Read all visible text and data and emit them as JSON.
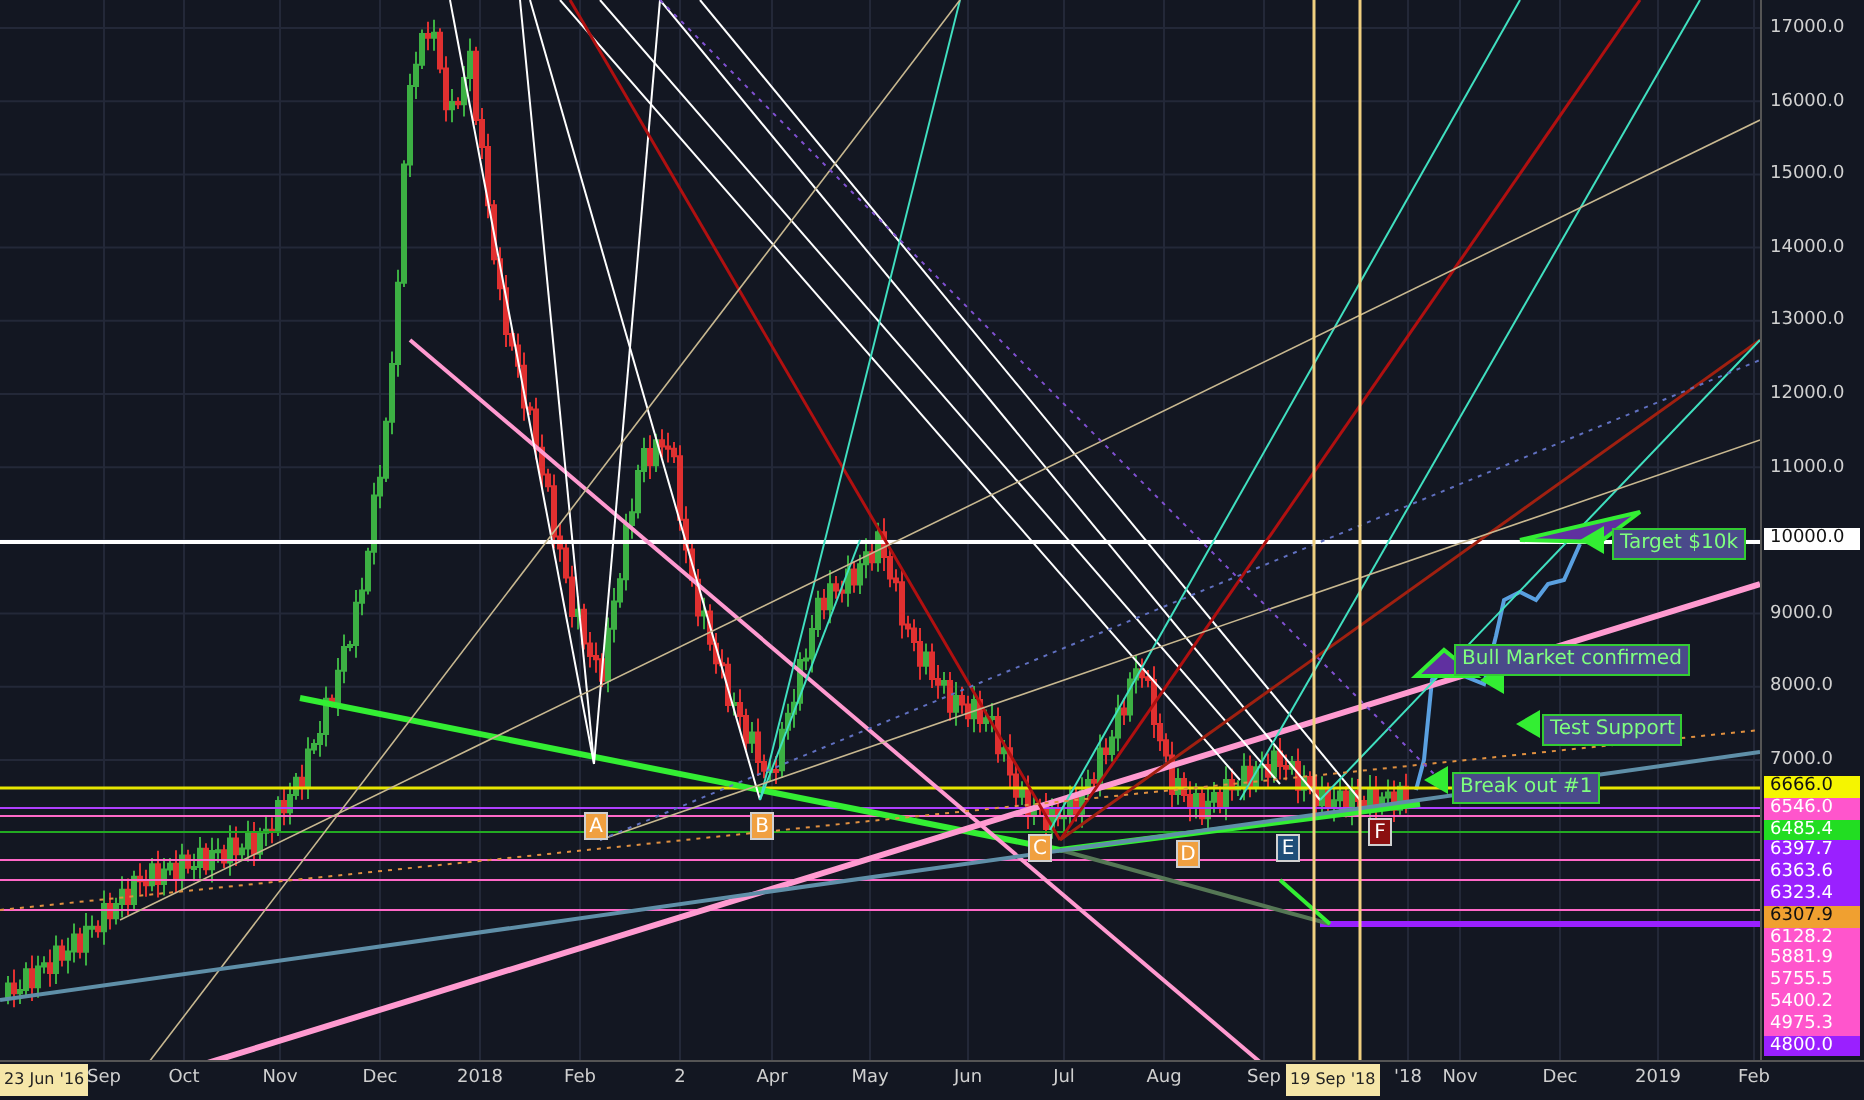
{
  "chart": {
    "markers": [
      {
        "text": "A",
        "color": "#f0a040"
      },
      {
        "text": "B",
        "color": "#f0a040"
      },
      {
        "text": "C",
        "color": "#f0a040"
      },
      {
        "text": "D",
        "color": "#f0a040"
      },
      {
        "text": "E",
        "color": "#1f4e79"
      },
      {
        "text": "F",
        "color": "#8b1010"
      }
    ],
    "annotations": [
      {
        "text": "Target $10k"
      },
      {
        "text": "Bull Market confirmed"
      },
      {
        "text": "Test Support"
      },
      {
        "text": "Break out #1"
      }
    ]
  },
  "price_axis": {
    "labels": [
      "17000.0",
      "16000.0",
      "15000.0",
      "14000.0",
      "13000.0",
      "12000.0",
      "11000.0",
      "9000.0",
      "8000.0",
      "7000.0"
    ],
    "line_tag": {
      "text": "10000.0",
      "color": "#ffffff"
    },
    "tags": [
      {
        "text": "6666.0",
        "color": "#f5f500"
      },
      {
        "text": "6546.0",
        "color": "#ff55cc"
      },
      {
        "text": "6485.4",
        "color": "#22dd22"
      },
      {
        "text": "6397.7",
        "color": "#9a20ff"
      },
      {
        "text": "6363.6",
        "color": "#9a20ff"
      },
      {
        "text": "6323.4",
        "color": "#9a20ff"
      },
      {
        "text": "6307.9",
        "color": "#f0a030"
      },
      {
        "text": "6128.2",
        "color": "#ff55cc"
      },
      {
        "text": "5881.9",
        "color": "#ff55cc"
      },
      {
        "text": "5755.5",
        "color": "#ff55cc"
      },
      {
        "text": "5400.2",
        "color": "#ff55cc"
      },
      {
        "text": "4975.3",
        "color": "#ff55cc"
      },
      {
        "text": "4800.0",
        "color": "#9a20ff"
      }
    ]
  },
  "time_axis": {
    "labels": [
      "Sep",
      "Oct",
      "Nov",
      "Dec",
      "2018",
      "Feb",
      "2",
      "Apr",
      "May",
      "Jun",
      "Jul",
      "Aug",
      "Sep",
      "'18",
      "Nov",
      "Dec",
      "2019",
      "Feb"
    ],
    "tags": [
      {
        "text": "23 Jun '16"
      },
      {
        "text": "19 Sep '18"
      }
    ]
  }
}
